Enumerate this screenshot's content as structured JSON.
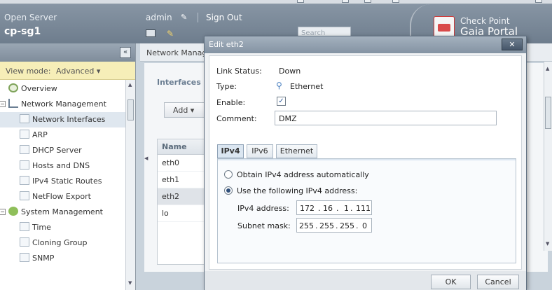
{
  "header": {
    "app_name": "Open Server",
    "hostname": "cp-sg1",
    "user": "admin",
    "signout_label": "Sign Out",
    "search_placeholder": "Search",
    "brand_line1": "Check Point",
    "brand_line2": "Gaia Portal"
  },
  "sidebar": {
    "view_mode_label": "View mode:",
    "view_mode_value": "Advanced ▾",
    "items": [
      {
        "label": "Overview"
      },
      {
        "label": "Network Management"
      },
      {
        "label": "Network Interfaces"
      },
      {
        "label": "ARP"
      },
      {
        "label": "DHCP Server"
      },
      {
        "label": "Hosts and DNS"
      },
      {
        "label": "IPv4 Static Routes"
      },
      {
        "label": "NetFlow Export"
      },
      {
        "label": "System Management"
      },
      {
        "label": "Time"
      },
      {
        "label": "Cloning Group"
      },
      {
        "label": "SNMP"
      }
    ]
  },
  "main": {
    "breadcrumb": "Network Manage",
    "section_title": "Interfaces",
    "add_label": "Add ▾",
    "grid_header": "Name",
    "rows": [
      "eth0",
      "eth1",
      "eth2",
      "lo"
    ]
  },
  "dialog": {
    "title": "Edit eth2",
    "close_label": "✕",
    "link_status_label": "Link Status:",
    "link_status_value": "Down",
    "type_label": "Type:",
    "type_value": "Ethernet",
    "enable_label": "Enable:",
    "enable_checked": true,
    "comment_label": "Comment:",
    "comment_value": "DMZ",
    "tabs": [
      {
        "label": "IPv4",
        "active": true
      },
      {
        "label": "IPv6",
        "active": false
      },
      {
        "label": "Ethernet",
        "active": false
      }
    ],
    "radio_auto": "Obtain IPv4 address automatically",
    "radio_manual": "Use the following IPv4 address:",
    "selected_option": "manual",
    "ipv4_label": "IPv4 address:",
    "ipv4_octets": [
      "172",
      "16",
      "1",
      "111"
    ],
    "mask_label": "Subnet mask:",
    "mask_octets": [
      "255",
      "255",
      "255",
      "0"
    ],
    "ok_label": "OK",
    "cancel_label": "Cancel"
  }
}
